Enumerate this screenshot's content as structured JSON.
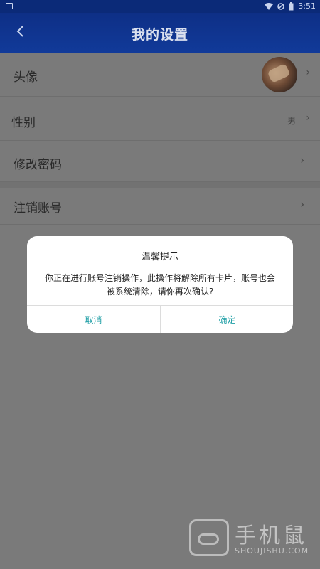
{
  "status_bar": {
    "time": "3:51"
  },
  "header": {
    "title": "我的设置",
    "back_icon": "chevron-left-icon"
  },
  "settings": {
    "avatar_label": "头像",
    "gender_label": "性别",
    "gender_value": "男",
    "password_label": "修改密码",
    "cancel_account_label": "注销账号",
    "chevron": "›"
  },
  "dialog": {
    "title": "温馨提示",
    "message": "你正在进行账号注销操作，此操作将解除所有卡片，账号也会被系统清除，请你再次确认?",
    "cancel_label": "取消",
    "confirm_label": "确定"
  },
  "watermark": {
    "brand": "手机鼠",
    "site": "SHOUJISHU.COM"
  },
  "colors": {
    "header_bg": "#113a99",
    "overlay": "#7a7a7a",
    "dialog_button": "#1f9fa6"
  }
}
